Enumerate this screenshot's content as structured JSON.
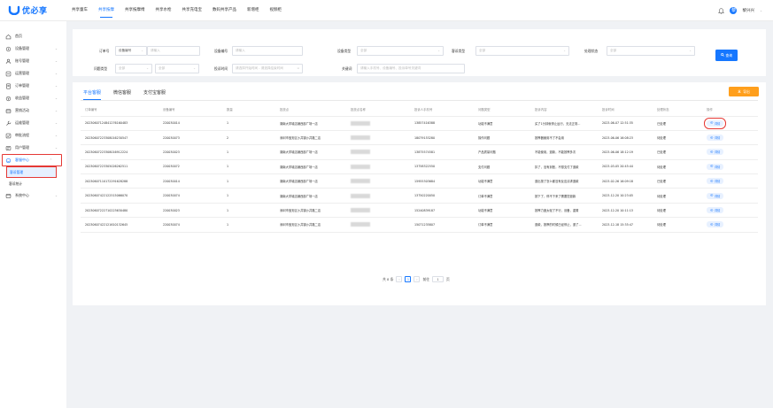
{
  "brand": {
    "name": "优必享"
  },
  "topnav": [
    {
      "label": "共享童车",
      "active": false
    },
    {
      "label": "共享按摩",
      "active": true
    },
    {
      "label": "共享按摩椅",
      "active": false
    },
    {
      "label": "共享水枪",
      "active": false
    },
    {
      "label": "共享充电宝",
      "active": false
    },
    {
      "label": "数码共享产品",
      "active": false
    },
    {
      "label": "新增柜",
      "active": false
    },
    {
      "label": "视频柜",
      "active": false
    }
  ],
  "user": {
    "name": "黎兴兴",
    "avatar": "黎"
  },
  "sidebar": {
    "items": [
      {
        "label": "首页",
        "icon": "home-icon"
      },
      {
        "label": "设备管理",
        "icon": "device-icon"
      },
      {
        "label": "账号管理",
        "icon": "user-icon"
      },
      {
        "label": "运营管理",
        "icon": "operation-icon"
      },
      {
        "label": "订单管理",
        "icon": "order-icon"
      },
      {
        "label": "收益管理",
        "icon": "income-icon"
      },
      {
        "label": "营销活动",
        "icon": "marketing-icon"
      },
      {
        "label": "运维管理",
        "icon": "maintain-icon"
      },
      {
        "label": "审批流程",
        "icon": "approve-icon"
      },
      {
        "label": "用户管理",
        "icon": "customer-icon"
      },
      {
        "label": "客服中心",
        "icon": "service-icon"
      },
      {
        "label": "系统中心",
        "icon": "system-icon"
      }
    ],
    "subitems": [
      {
        "label": "客诉管理",
        "active": true
      },
      {
        "label": "客诉统计",
        "active": false
      }
    ]
  },
  "filters": {
    "order_type": {
      "label": "订单号",
      "select": "设备编号",
      "placeholder": "请输入"
    },
    "device_no": {
      "label": "设备编号",
      "placeholder": "请输入"
    },
    "channel": {
      "label": "设备类型",
      "placeholder": "全部"
    },
    "complaint_type": {
      "label": "客诉类型",
      "placeholder": "全部"
    },
    "handle_status": {
      "label": "处理状态",
      "placeholder": "全部"
    },
    "question_type": {
      "label": "问题类型",
      "placeholder": "全部",
      "placeholder2": "全部"
    },
    "time": {
      "label": "投诉时间",
      "placeholder": "请选择开始时间 - 请选择结束时间"
    },
    "keyword": {
      "label": "关键词",
      "placeholder": "请输入手机号、设备编号、投诉单号关键词"
    },
    "search_label": "查询"
  },
  "tabs": [
    {
      "label": "平台客服",
      "active": true
    },
    {
      "label": "微信客服",
      "active": false
    },
    {
      "label": "支付宝客服",
      "active": false
    }
  ],
  "export_label": "导出",
  "columns": [
    "订单编号",
    "设备编号",
    "数量",
    "投放点",
    "投放点名称",
    "投诉人手机号",
    "问题类型",
    "投诉内容",
    "投诉时间",
    "处理状态",
    "操作"
  ],
  "rows": [
    {
      "order": "20230607124841276160483",
      "device": "220030014",
      "qty": "1",
      "site": "湖南大学城店铺西部广场一店",
      "phone": "13857416388",
      "type": "功能不满意",
      "content": "买了1分钟就停止运行，无法正常...",
      "time": "2023-06-07 12:51:35",
      "status": "已处理",
      "action": "详情"
    },
    {
      "order": "20230607223308016230547",
      "device": "220030073",
      "qty": "2",
      "site": "深圳市宝安区沙井镇沙井路二店",
      "phone": "18079153280",
      "type": "操作问题",
      "content": "按摩器使用不了不会用",
      "time": "2023-06-06 16:08:23",
      "status": "待处理",
      "action": "详情"
    },
    {
      "order": "20230607223308016912224",
      "device": "220030023",
      "qty": "1",
      "site": "湖南大学城店铺西部广场一店",
      "phone": "13875574581",
      "type": "产品质量问题",
      "content": "不能使用，退款，不能按摩多次",
      "time": "2023-06-06 18:12:19",
      "status": "已处理",
      "action": "详情"
    },
    {
      "order": "20230607223305026262511",
      "device": "220030072",
      "qty": "1",
      "site": "湖南大学城店铺西部广场一店",
      "phone": "13758322550",
      "type": "支付问题",
      "content": "扣了，没有到账，不想支付了退款",
      "time": "2023-03-05 20:45:44",
      "status": "待处理",
      "action": "详情"
    },
    {
      "order": "20230607110172291628288",
      "device": "220030014",
      "qty": "1",
      "site": "湖南大学城店铺西部广场一店",
      "phone": "15955303684",
      "type": "功能不满意",
      "content": "退出按了怎么都没有反应请求退款",
      "time": "2023-02-26 16:09:18",
      "status": "已处理",
      "action": "详情"
    },
    {
      "order": "20230607422122515066070",
      "device": "220030074",
      "qty": "1",
      "site": "湖南大学城店铺西部广场一店",
      "phone": "13750220050",
      "type": "订单不满意",
      "content": "按下了，停不下来了需要您退款",
      "time": "2023-12-20 10:23:05",
      "status": "待处理",
      "action": "详情"
    },
    {
      "order": "20230607222710223630480",
      "device": "220030023",
      "qty": "1",
      "site": "深圳市宝安区沙井镇沙井路二店",
      "phone": "15240839187",
      "type": "功能不满意",
      "content": "按摩力度太轻了不行，设备，重置",
      "time": "2023-12-20 10:11:13",
      "status": "待处理",
      "action": "详情"
    },
    {
      "order": "20230607422121610132645",
      "device": "220030074",
      "qty": "1",
      "site": "深圳市宝安区沙井镇沙井路二店",
      "phone": "15071235807",
      "type": "订单不满意",
      "content": "退款，按摩的时候已经停止，退了...",
      "time": "2023-12-18 15:35:47",
      "status": "待处理",
      "action": "详情"
    }
  ],
  "pagination": {
    "total": "共 8 条",
    "current": "1",
    "goto_label": "前往",
    "goto_value": "1",
    "page_suffix": "页"
  },
  "colors": {
    "primary": "#1677ff",
    "export": "#ff9f1c",
    "highlight": "#e53935"
  }
}
